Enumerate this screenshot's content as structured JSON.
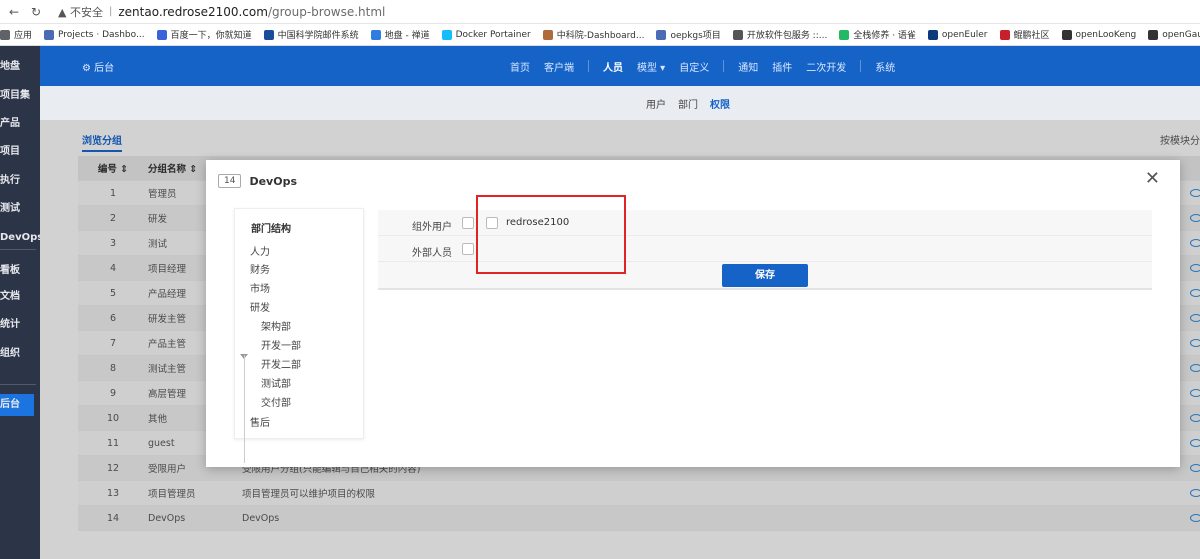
{
  "browser": {
    "insecure_label": "不安全",
    "url_host": "zentao.redrose2100.com",
    "url_path": "/group-browse.html"
  },
  "bookmarks": [
    {
      "label": "应用",
      "color": "#5f6368"
    },
    {
      "label": "Projects · Dashbo...",
      "color": "#4b6bb5"
    },
    {
      "label": "百度一下，你就知道",
      "color": "#3a62d9"
    },
    {
      "label": "中国科学院邮件系统",
      "color": "#1a4d99"
    },
    {
      "label": "地盘 - 禅道",
      "color": "#2f7de1"
    },
    {
      "label": "Docker Portainer",
      "color": "#13bef9"
    },
    {
      "label": "中科院-Dashboard...",
      "color": "#b06b3a"
    },
    {
      "label": "oepkgs项目",
      "color": "#4b6bb5"
    },
    {
      "label": "开放软件包服务 ::...",
      "color": "#555555"
    },
    {
      "label": "全栈修养 · 语雀",
      "color": "#25b864"
    },
    {
      "label": "openEuler",
      "color": "#0c3a7a"
    },
    {
      "label": "鲲鹏社区",
      "color": "#c8202b"
    },
    {
      "label": "openLooKeng",
      "color": "#333333"
    },
    {
      "label": "openGauss | ope",
      "color": "#333333"
    }
  ],
  "sidebar": {
    "items": [
      "地盘",
      "项目集",
      "产品",
      "项目",
      "执行",
      "测试",
      "DevOps",
      "看板",
      "文档",
      "统计",
      "组织",
      "后台"
    ],
    "active": "后台"
  },
  "topbar": {
    "back_label": "⚙ 后台",
    "nav": [
      "首页",
      "客户端",
      "人员",
      "模型 ▾",
      "自定义",
      "通知",
      "插件",
      "二次开发",
      "系统"
    ],
    "active": "人员"
  },
  "subnav": {
    "items": [
      "用户",
      "部门",
      "权限"
    ],
    "active": "权限"
  },
  "content": {
    "browse_tab": "浏览分组",
    "by_module": "按模块分",
    "headers": [
      "编号 ⇕",
      "分组名称 ⇕"
    ],
    "rows": [
      {
        "id": "1",
        "name": "管理员",
        "desc": ""
      },
      {
        "id": "2",
        "name": "研发",
        "desc": ""
      },
      {
        "id": "3",
        "name": "测试",
        "desc": ""
      },
      {
        "id": "4",
        "name": "项目经理",
        "desc": ""
      },
      {
        "id": "5",
        "name": "产品经理",
        "desc": ""
      },
      {
        "id": "6",
        "name": "研发主管",
        "desc": ""
      },
      {
        "id": "7",
        "name": "产品主管",
        "desc": ""
      },
      {
        "id": "8",
        "name": "测试主管",
        "desc": ""
      },
      {
        "id": "9",
        "name": "高层管理",
        "desc": ""
      },
      {
        "id": "10",
        "name": "其他",
        "desc": ""
      },
      {
        "id": "11",
        "name": "guest",
        "desc": ""
      },
      {
        "id": "12",
        "name": "受限用户",
        "desc": "受限用户分组(只能编辑与自己相关的内容)"
      },
      {
        "id": "13",
        "name": "项目管理员",
        "desc": "项目管理员可以维护项目的权限"
      },
      {
        "id": "14",
        "name": "DevOps",
        "desc": "DevOps"
      }
    ]
  },
  "modal": {
    "id_badge": "14",
    "title": "DevOps",
    "close": "✕",
    "dept_title": "部门结构",
    "depts_top": [
      "人力",
      "财务",
      "市场"
    ],
    "dept_parent": "研发",
    "depts_child": [
      "架构部",
      "开发一部",
      "开发二部",
      "测试部",
      "交付部"
    ],
    "dept_last": "售后",
    "outside_label": "组外用户",
    "external_label": "外部人员",
    "user": "redrose2100",
    "save": "保存"
  }
}
